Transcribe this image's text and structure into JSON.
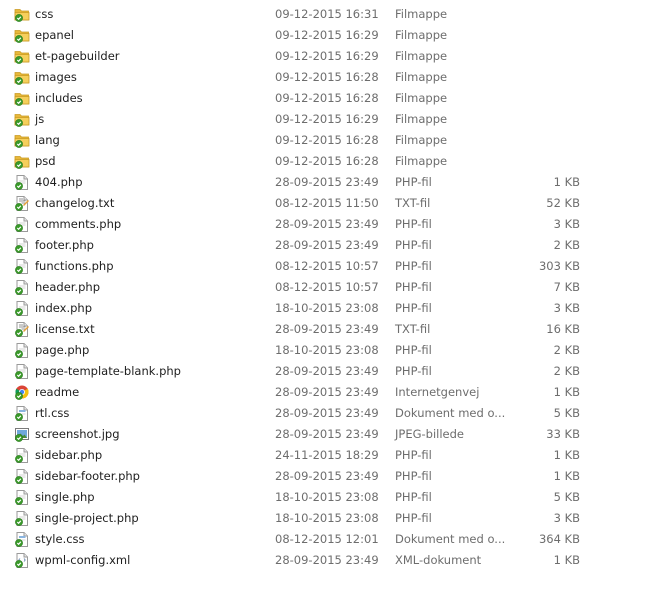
{
  "files": [
    {
      "name": "css",
      "date": "09-12-2015 16:31",
      "type": "Filmappe",
      "size": "",
      "icon": "folder-icon"
    },
    {
      "name": "epanel",
      "date": "09-12-2015 16:29",
      "type": "Filmappe",
      "size": "",
      "icon": "folder-icon"
    },
    {
      "name": "et-pagebuilder",
      "date": "09-12-2015 16:29",
      "type": "Filmappe",
      "size": "",
      "icon": "folder-icon"
    },
    {
      "name": "images",
      "date": "09-12-2015 16:28",
      "type": "Filmappe",
      "size": "",
      "icon": "folder-icon"
    },
    {
      "name": "includes",
      "date": "09-12-2015 16:28",
      "type": "Filmappe",
      "size": "",
      "icon": "folder-icon"
    },
    {
      "name": "js",
      "date": "09-12-2015 16:29",
      "type": "Filmappe",
      "size": "",
      "icon": "folder-icon"
    },
    {
      "name": "lang",
      "date": "09-12-2015 16:28",
      "type": "Filmappe",
      "size": "",
      "icon": "folder-icon"
    },
    {
      "name": "psd",
      "date": "09-12-2015 16:28",
      "type": "Filmappe",
      "size": "",
      "icon": "folder-icon"
    },
    {
      "name": "404.php",
      "date": "28-09-2015 23:49",
      "type": "PHP-fil",
      "size": "1 KB",
      "icon": "php-file-icon"
    },
    {
      "name": "changelog.txt",
      "date": "08-12-2015 11:50",
      "type": "TXT-fil",
      "size": "52 KB",
      "icon": "txt-file-icon"
    },
    {
      "name": "comments.php",
      "date": "28-09-2015 23:49",
      "type": "PHP-fil",
      "size": "3 KB",
      "icon": "php-file-icon"
    },
    {
      "name": "footer.php",
      "date": "28-09-2015 23:49",
      "type": "PHP-fil",
      "size": "2 KB",
      "icon": "php-file-icon"
    },
    {
      "name": "functions.php",
      "date": "08-12-2015 10:57",
      "type": "PHP-fil",
      "size": "303 KB",
      "icon": "php-file-icon"
    },
    {
      "name": "header.php",
      "date": "08-12-2015 10:57",
      "type": "PHP-fil",
      "size": "7 KB",
      "icon": "php-file-icon"
    },
    {
      "name": "index.php",
      "date": "18-10-2015 23:08",
      "type": "PHP-fil",
      "size": "3 KB",
      "icon": "php-file-icon"
    },
    {
      "name": "license.txt",
      "date": "28-09-2015 23:49",
      "type": "TXT-fil",
      "size": "16 KB",
      "icon": "txt-file-icon"
    },
    {
      "name": "page.php",
      "date": "18-10-2015 23:08",
      "type": "PHP-fil",
      "size": "2 KB",
      "icon": "php-file-icon"
    },
    {
      "name": "page-template-blank.php",
      "date": "28-09-2015 23:49",
      "type": "PHP-fil",
      "size": "2 KB",
      "icon": "php-file-icon"
    },
    {
      "name": "readme",
      "date": "28-09-2015 23:49",
      "type": "Internetgenvej",
      "size": "1 KB",
      "icon": "chrome-shortcut-icon"
    },
    {
      "name": "rtl.css",
      "date": "28-09-2015 23:49",
      "type": "Dokument med o...",
      "size": "5 KB",
      "icon": "css-file-icon"
    },
    {
      "name": "screenshot.jpg",
      "date": "28-09-2015 23:49",
      "type": "JPEG-billede",
      "size": "33 KB",
      "icon": "image-file-icon"
    },
    {
      "name": "sidebar.php",
      "date": "24-11-2015 18:29",
      "type": "PHP-fil",
      "size": "1 KB",
      "icon": "php-file-icon"
    },
    {
      "name": "sidebar-footer.php",
      "date": "28-09-2015 23:49",
      "type": "PHP-fil",
      "size": "1 KB",
      "icon": "php-file-icon"
    },
    {
      "name": "single.php",
      "date": "18-10-2015 23:08",
      "type": "PHP-fil",
      "size": "5 KB",
      "icon": "php-file-icon"
    },
    {
      "name": "single-project.php",
      "date": "18-10-2015 23:08",
      "type": "PHP-fil",
      "size": "3 KB",
      "icon": "php-file-icon"
    },
    {
      "name": "style.css",
      "date": "08-12-2015 12:01",
      "type": "Dokument med o...",
      "size": "364 KB",
      "icon": "css-file-icon"
    },
    {
      "name": "wpml-config.xml",
      "date": "28-09-2015 23:49",
      "type": "XML-dokument",
      "size": "1 KB",
      "icon": "xml-file-icon"
    }
  ]
}
